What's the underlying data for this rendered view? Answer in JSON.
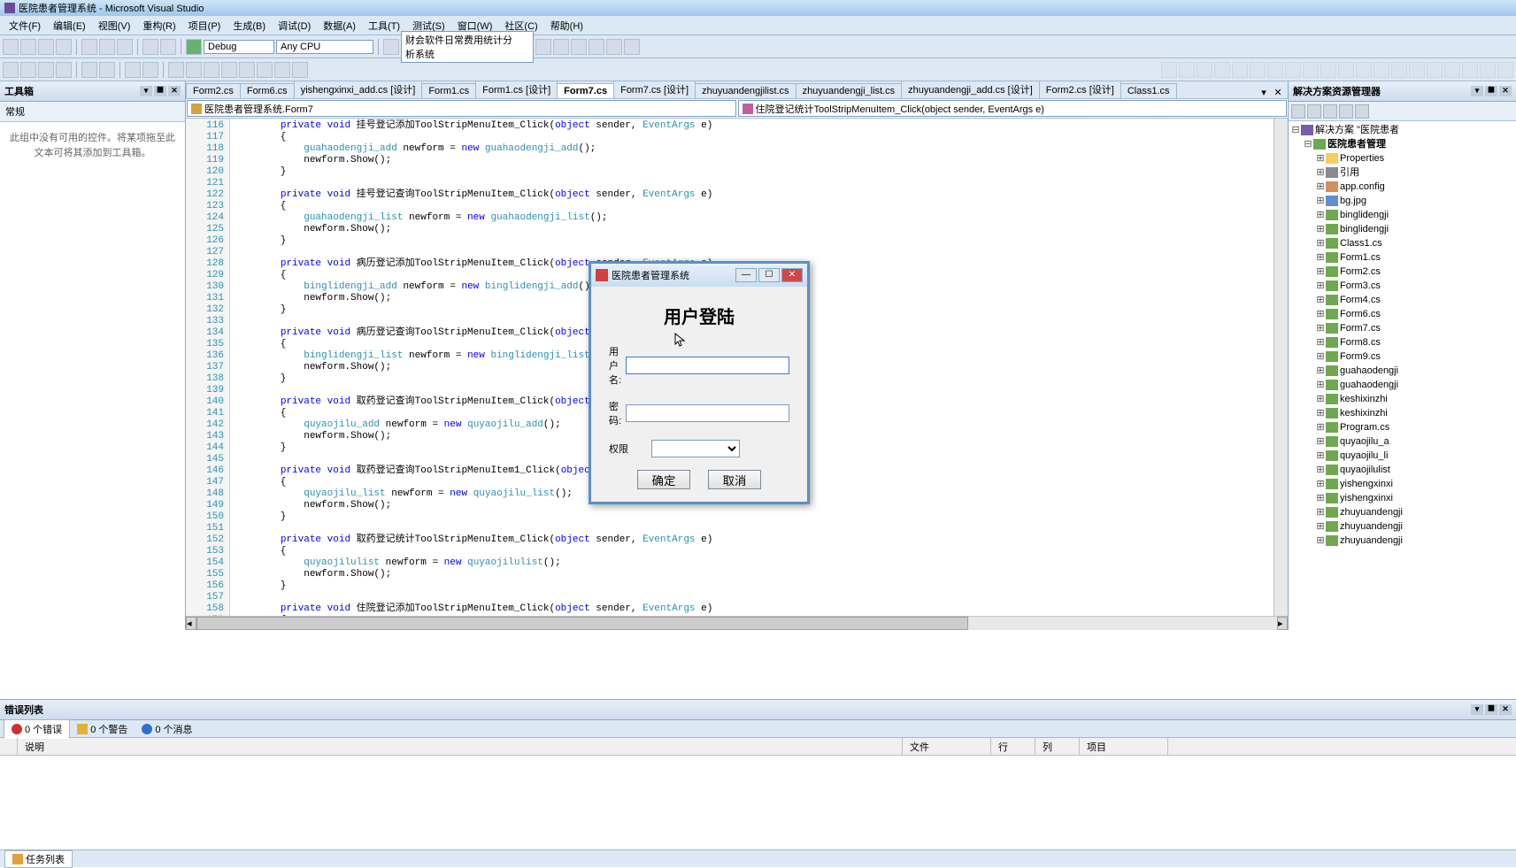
{
  "app_title": "医院患者管理系统 - Microsoft Visual Studio",
  "menu": [
    "文件(F)",
    "编辑(E)",
    "视图(V)",
    "重构(R)",
    "项目(P)",
    "生成(B)",
    "调试(D)",
    "数据(A)",
    "工具(T)",
    "测试(S)",
    "窗口(W)",
    "社区(C)",
    "帮助(H)"
  ],
  "toolbar_config": "Debug",
  "toolbar_platform": "Any CPU",
  "toolbar_project": "财会软件日常费用统计分析系统",
  "toolbox": {
    "title": "工具箱",
    "category": "常规",
    "empty_msg": "此组中没有可用的控件。将某项拖至此文本可将其添加到工具箱。"
  },
  "doc_tabs": [
    "Form2.cs",
    "Form6.cs",
    "yishengxinxi_add.cs [设计]",
    "Form1.cs",
    "Form1.cs [设计]",
    "Form7.cs",
    "Form7.cs [设计]",
    "zhuyuandengjilist.cs",
    "zhuyuandengji_list.cs",
    "zhuyuandengji_add.cs [设计]",
    "Form2.cs [设计]",
    "Class1.cs"
  ],
  "active_tab": 5,
  "nav_left": "医院患者管理系统.Form7",
  "nav_right": "住院登记统计ToolStripMenuItem_Click(object sender, EventArgs e)",
  "line_start": 116,
  "solution": {
    "title": "解决方案资源管理器",
    "root": "解决方案 \"医院患者",
    "project": "医院患者管理",
    "nodes": [
      {
        "t": "Properties",
        "k": "fold"
      },
      {
        "t": "引用",
        "k": "ref"
      },
      {
        "t": "app.config",
        "k": "cfg"
      },
      {
        "t": "bg.jpg",
        "k": "img"
      },
      {
        "t": "binglidengji",
        "k": "cs"
      },
      {
        "t": "binglidengji",
        "k": "cs"
      },
      {
        "t": "Class1.cs",
        "k": "cs"
      },
      {
        "t": "Form1.cs",
        "k": "cs"
      },
      {
        "t": "Form2.cs",
        "k": "cs"
      },
      {
        "t": "Form3.cs",
        "k": "cs"
      },
      {
        "t": "Form4.cs",
        "k": "cs"
      },
      {
        "t": "Form6.cs",
        "k": "cs"
      },
      {
        "t": "Form7.cs",
        "k": "cs"
      },
      {
        "t": "Form8.cs",
        "k": "cs"
      },
      {
        "t": "Form9.cs",
        "k": "cs"
      },
      {
        "t": "guahaodengji",
        "k": "cs"
      },
      {
        "t": "guahaodengji",
        "k": "cs"
      },
      {
        "t": "keshixinzhi",
        "k": "cs"
      },
      {
        "t": "keshixinzhi",
        "k": "cs"
      },
      {
        "t": "Program.cs",
        "k": "cs"
      },
      {
        "t": "quyaojilu_a",
        "k": "cs"
      },
      {
        "t": "quyaojilu_li",
        "k": "cs"
      },
      {
        "t": "quyaojilulist",
        "k": "cs"
      },
      {
        "t": "yishengxinxi",
        "k": "cs"
      },
      {
        "t": "yishengxinxi",
        "k": "cs"
      },
      {
        "t": "zhuyuandengji",
        "k": "cs"
      },
      {
        "t": "zhuyuandengji",
        "k": "cs"
      },
      {
        "t": "zhuyuandengji",
        "k": "cs"
      }
    ]
  },
  "error_list": {
    "title": "错误列表",
    "errors": "0 个错误",
    "warnings": "0 个警告",
    "messages": "0 个消息",
    "cols": [
      "",
      "说明",
      "文件",
      "行",
      "列",
      "项目"
    ]
  },
  "status_tab": "任务列表",
  "dialog": {
    "title": "医院患者管理系统",
    "heading": "用户登陆",
    "user_label": "用户名:",
    "pass_label": "密码:",
    "perm_label": "权限",
    "ok": "确定",
    "cancel": "取消"
  }
}
